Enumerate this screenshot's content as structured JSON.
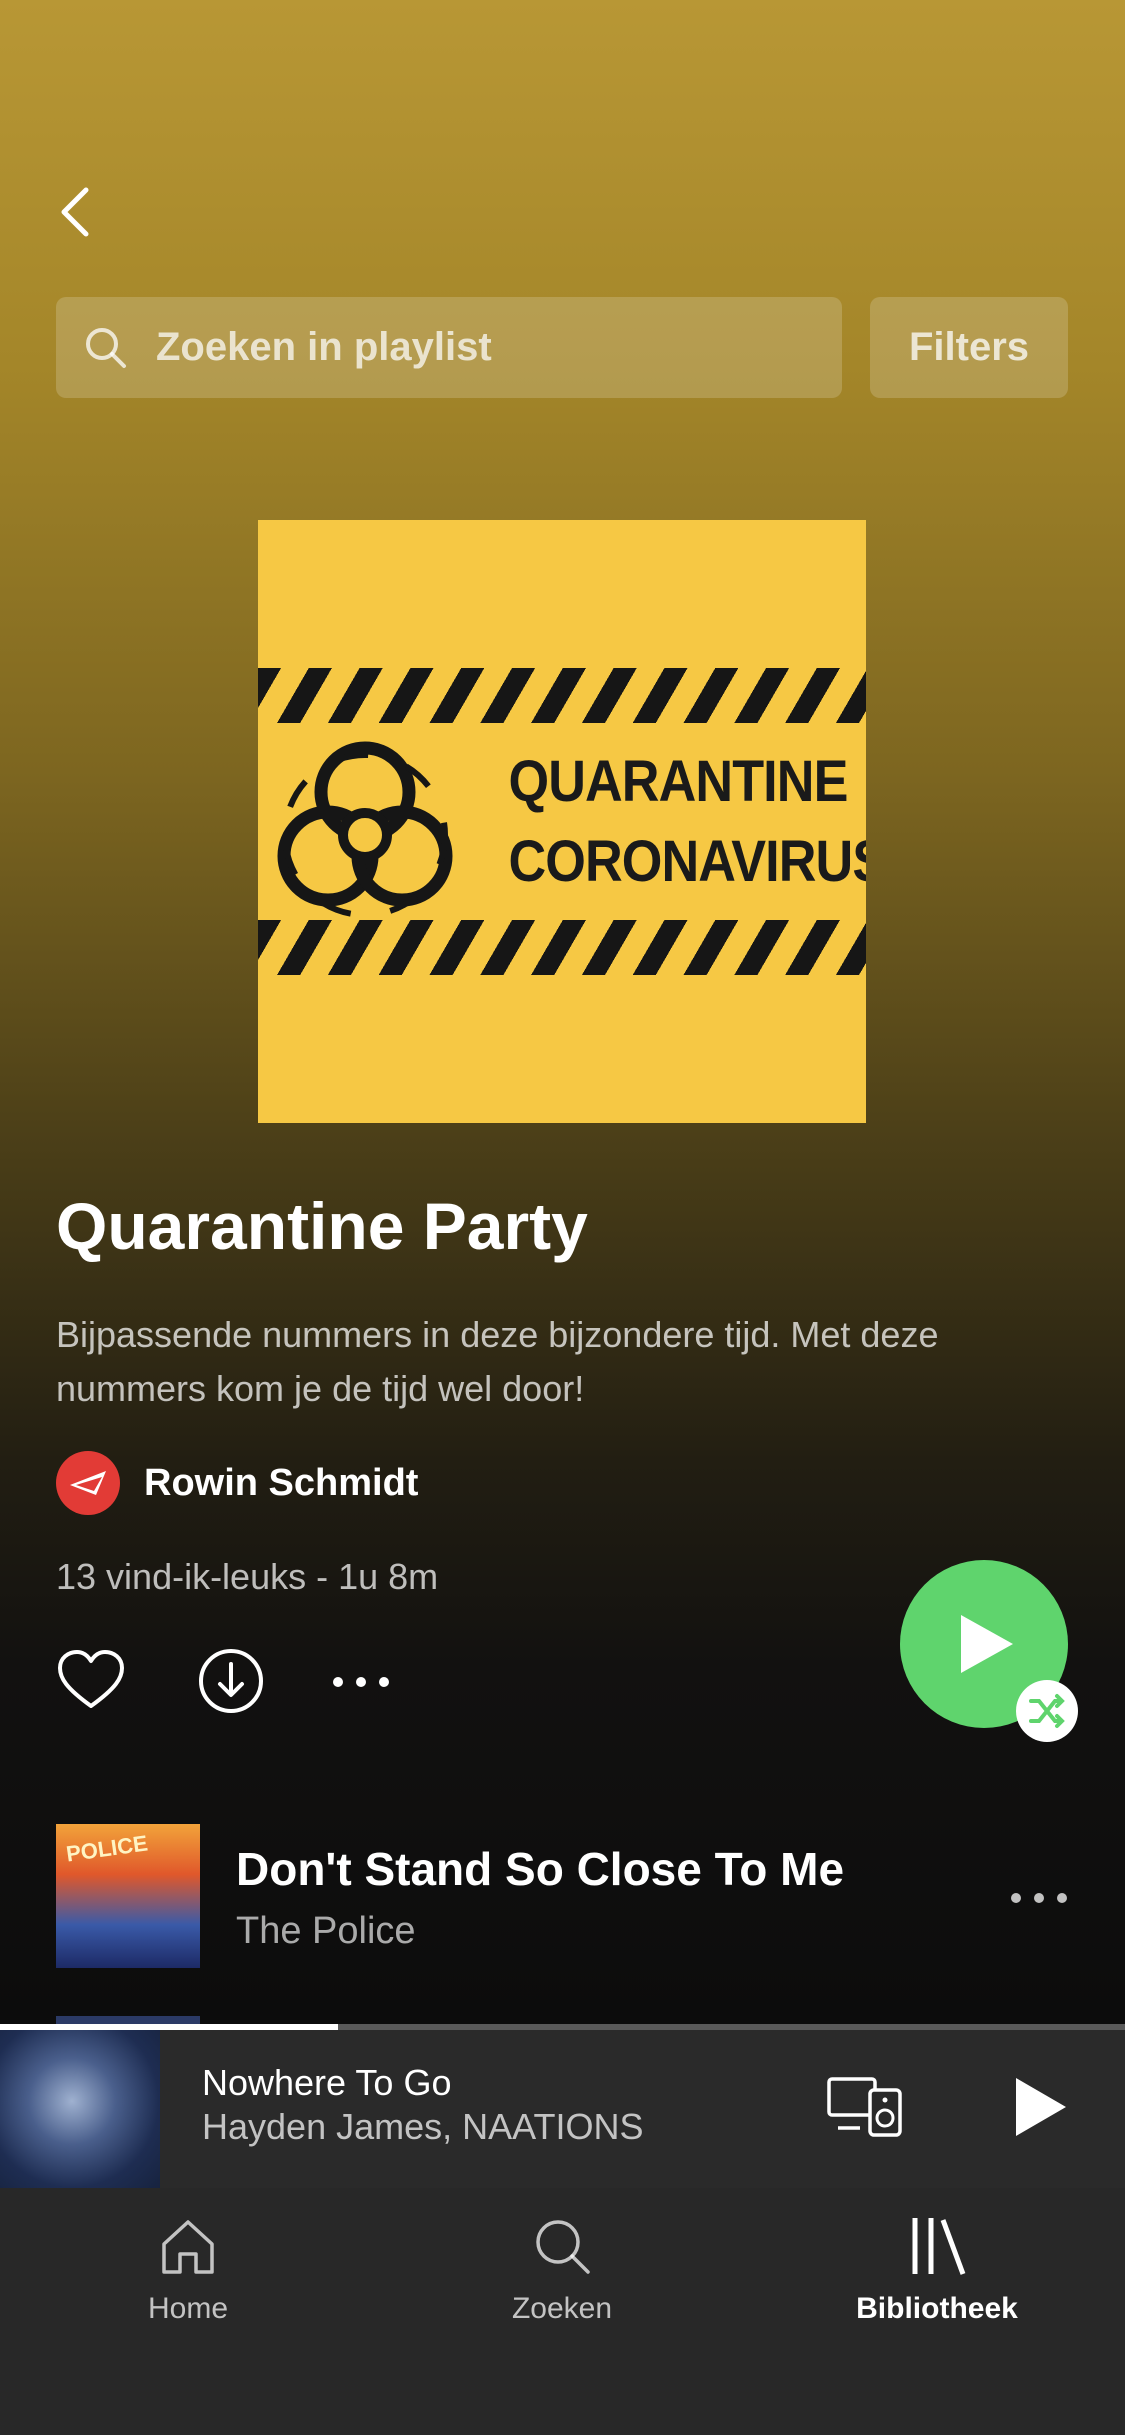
{
  "header": {
    "back_icon": "chevron-left-icon",
    "search_placeholder": "Zoeken in playlist",
    "filters_label": "Filters"
  },
  "cover": {
    "line1": "QUARANTINE",
    "line2": "CORONAVIRUS",
    "background": "#f6c844"
  },
  "playlist": {
    "title": "Quarantine Party",
    "description": "Bijpassende nummers in deze bijzondere tijd. Met deze nummers kom je de tijd wel door!",
    "owner": "Rowin Schmidt",
    "meta": "13 vind-ik-leuks - 1u 8m"
  },
  "colors": {
    "accent_green": "#5fd46d",
    "header_gold": "#b89735"
  },
  "tracks": [
    {
      "title": "Don't Stand So Close To Me",
      "artist": "The Police",
      "art_text": "POLICE"
    }
  ],
  "now_playing": {
    "title": "Nowhere To Go",
    "artist": "Hayden James, NAATIONS",
    "progress": 0.3
  },
  "tabs": [
    {
      "label": "Home",
      "icon": "home-icon",
      "active": false
    },
    {
      "label": "Zoeken",
      "icon": "search-icon",
      "active": false
    },
    {
      "label": "Bibliotheek",
      "icon": "library-icon",
      "active": true
    }
  ]
}
